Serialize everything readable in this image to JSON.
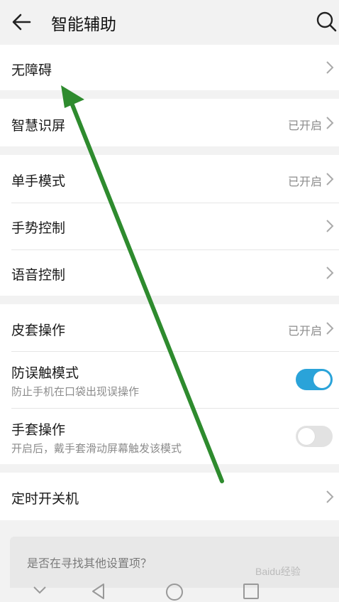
{
  "header": {
    "title": "智能辅助",
    "back_icon": "arrow-left-icon",
    "search_icon": "search-icon"
  },
  "groups": [
    {
      "items": [
        {
          "label": "无障碍"
        }
      ]
    },
    {
      "items": [
        {
          "label": "智慧识屏",
          "status": "已开启"
        }
      ]
    },
    {
      "items": [
        {
          "label": "单手模式",
          "status": "已开启"
        },
        {
          "label": "手势控制"
        },
        {
          "label": "语音控制"
        }
      ]
    },
    {
      "items": [
        {
          "label": "皮套操作",
          "status": "已开启"
        },
        {
          "label": "防误触模式",
          "subtitle": "防止手机在口袋出现误操作",
          "toggle": true
        },
        {
          "label": "手套操作",
          "subtitle": "开启后，戴手套滑动屏幕触发该模式",
          "toggle": false
        }
      ]
    },
    {
      "items": [
        {
          "label": "定时开关机"
        }
      ]
    }
  ],
  "suggestion": {
    "text": "是否在寻找其他设置项？"
  },
  "navbar": {
    "icons": [
      "chevron-down-icon",
      "back-triangle-icon",
      "home-circle-icon",
      "recents-square-icon"
    ]
  },
  "watermark": {
    "text": "Baidu经验"
  },
  "colors": {
    "toggle_on": "#2aa3d9",
    "annotation_arrow": "#2e8b2e"
  }
}
